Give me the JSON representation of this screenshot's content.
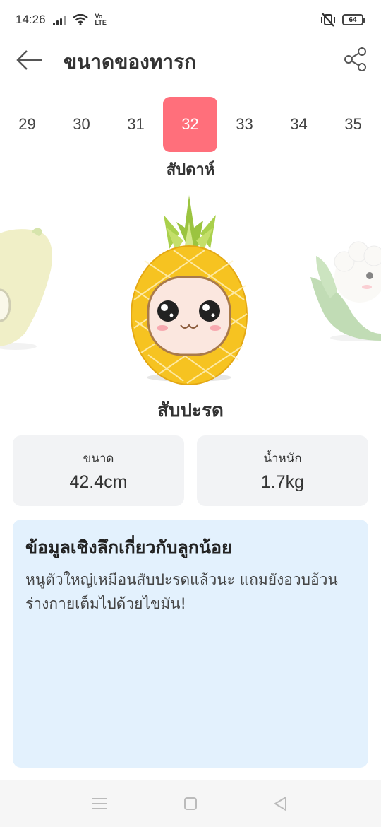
{
  "status_bar": {
    "time": "14:26",
    "volte_line1": "Vo",
    "volte_line2": "LTE",
    "battery": "64"
  },
  "header": {
    "title": "ขนาดของทารก",
    "back_icon": "arrow-left-icon",
    "share_icon": "share-icon"
  },
  "weeks": {
    "items": [
      "29",
      "30",
      "31",
      "32",
      "33",
      "34",
      "35"
    ],
    "selected": "32",
    "label": "สัปดาห์"
  },
  "fruit": {
    "name": "สับปะรด",
    "accent": "#ff6f7b"
  },
  "stats": {
    "size_label": "ขนาด",
    "size_value": "42.4cm",
    "weight_label": "น้ำหนัก",
    "weight_value": "1.7kg"
  },
  "insight": {
    "title": "ข้อมูลเชิงลึกเกี่ยวกับลูกน้อย",
    "body": "หนูตัวใหญ่เหมือนสับปะรดแล้วนะ แถมยังอวบอ้วน ร่างกายเต็มไปด้วยไขมัน!"
  },
  "navbar": {
    "menu_icon": "menu-icon",
    "home_icon": "square-home-icon",
    "back_icon": "triangle-back-icon"
  }
}
